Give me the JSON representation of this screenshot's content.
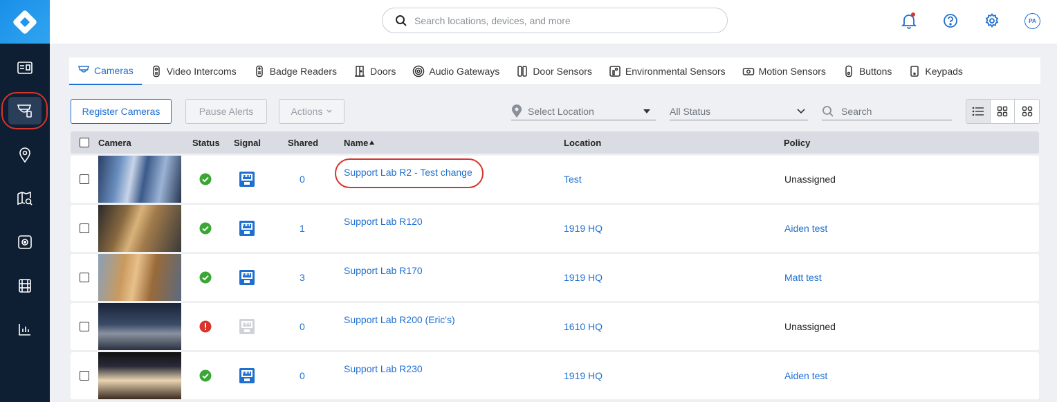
{
  "search": {
    "placeholder": "Search locations, devices, and more"
  },
  "header": {
    "avatar_initials": "PA"
  },
  "sidebar": {
    "items": [
      {
        "icon": "dashboard-icon"
      },
      {
        "icon": "devices-icon",
        "active": true
      },
      {
        "icon": "location-pin-icon"
      },
      {
        "icon": "map-search-icon"
      },
      {
        "icon": "vault-icon"
      },
      {
        "icon": "film-icon"
      },
      {
        "icon": "analytics-icon"
      }
    ]
  },
  "tabs": [
    {
      "label": "Cameras",
      "icon": "camera-icon",
      "active": true
    },
    {
      "label": "Video Intercoms",
      "icon": "intercom-icon"
    },
    {
      "label": "Badge Readers",
      "icon": "badge-reader-icon"
    },
    {
      "label": "Doors",
      "icon": "door-icon"
    },
    {
      "label": "Audio Gateways",
      "icon": "audio-gateway-icon"
    },
    {
      "label": "Door Sensors",
      "icon": "door-sensor-icon"
    },
    {
      "label": "Environmental Sensors",
      "icon": "environmental-sensor-icon"
    },
    {
      "label": "Motion Sensors",
      "icon": "motion-sensor-icon"
    },
    {
      "label": "Buttons",
      "icon": "button-device-icon"
    },
    {
      "label": "Keypads",
      "icon": "keypad-icon"
    }
  ],
  "toolbar": {
    "register_label": "Register Cameras",
    "pause_label": "Pause Alerts",
    "actions_label": "Actions",
    "location_placeholder": "Select Location",
    "status_value": "All Status",
    "search_placeholder": "Search"
  },
  "table": {
    "columns": {
      "camera": "Camera",
      "status": "Status",
      "signal": "Signal",
      "shared": "Shared",
      "name": "Name",
      "location": "Location",
      "policy": "Policy"
    },
    "rows": [
      {
        "status": "ok",
        "signal": "online",
        "shared": "0",
        "name": "Support Lab R2 - Test change",
        "location": "Test",
        "policy": "Unassigned",
        "policy_link": false
      },
      {
        "status": "ok",
        "signal": "online",
        "shared": "1",
        "name": "Support Lab R120",
        "location": "1919 HQ",
        "policy": "Aiden test",
        "policy_link": true
      },
      {
        "status": "ok",
        "signal": "online",
        "shared": "3",
        "name": "Support Lab R170",
        "location": "1919 HQ",
        "policy": "Matt test",
        "policy_link": true
      },
      {
        "status": "error",
        "signal": "offline",
        "shared": "0",
        "name": "Support Lab R200 (Eric's)",
        "location": "1610 HQ",
        "policy": "Unassigned",
        "policy_link": false
      },
      {
        "status": "ok",
        "signal": "online",
        "shared": "0",
        "name": "Support Lab R230",
        "location": "1919 HQ",
        "policy": "Aiden test",
        "policy_link": true
      }
    ]
  },
  "colors": {
    "accent": "#1e6fd0",
    "sidebar_bg": "#0f1f33",
    "ok": "#3aa635",
    "error": "#d9342b",
    "highlight": "#d9342b"
  }
}
